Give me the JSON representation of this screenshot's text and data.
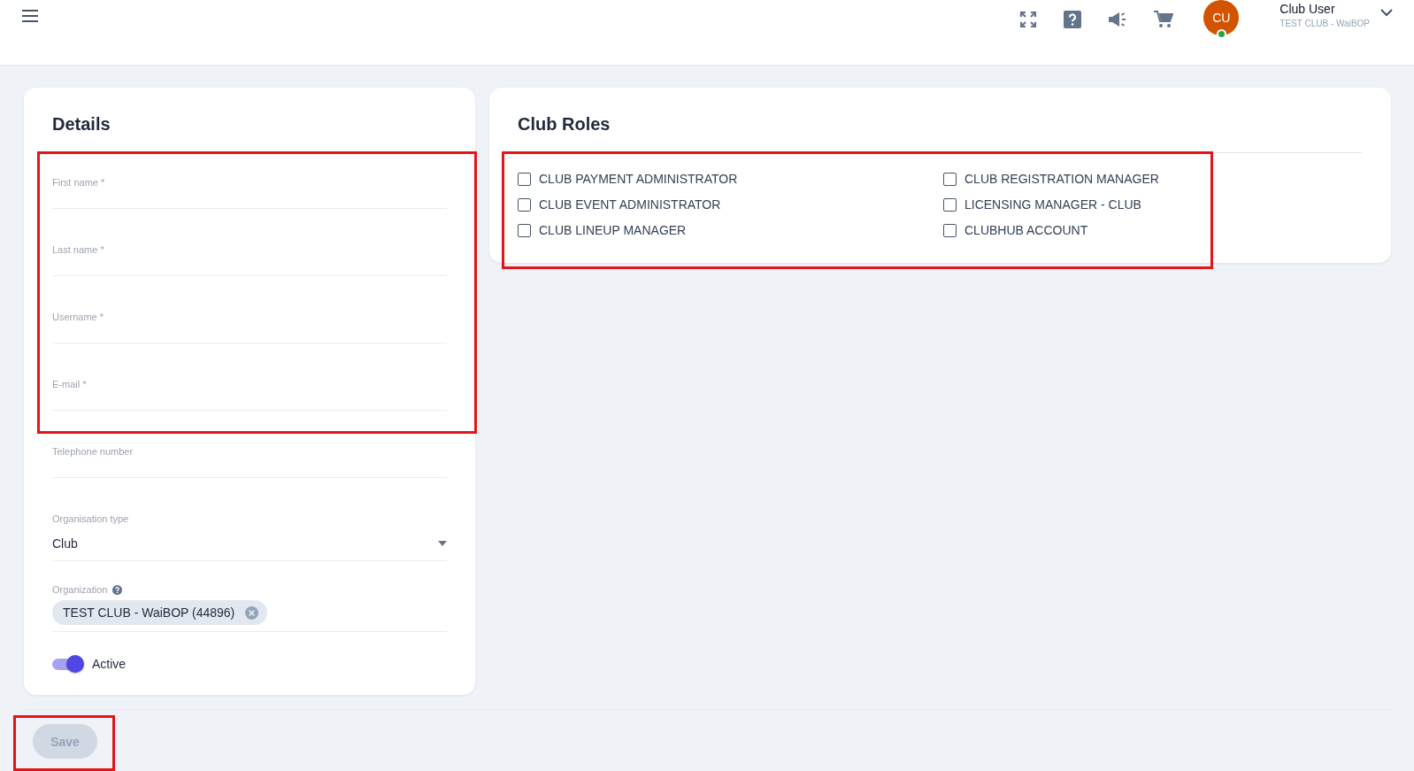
{
  "header": {
    "avatar": "CU",
    "online": true,
    "user_name": "Club User",
    "user_org": "TEST CLUB - WaiBOP"
  },
  "details": {
    "title": "Details",
    "fields": [
      {
        "kind": "text",
        "label": "First name *"
      },
      {
        "kind": "text",
        "label": "Last name *"
      },
      {
        "kind": "text",
        "label": "Username *"
      },
      {
        "kind": "text",
        "label": "E-mail *"
      },
      {
        "kind": "text",
        "label": "Telephone number"
      },
      {
        "kind": "select",
        "label": "Organisation type",
        "value": "Club"
      },
      {
        "kind": "chips",
        "label": "Organization",
        "chips": [
          "TEST CLUB - WaiBOP (44896)"
        ]
      }
    ],
    "active": {
      "label": "Active",
      "on": true
    }
  },
  "roles": {
    "title": "Club Roles",
    "items": [
      {
        "label": "CLUB PAYMENT ADMINISTRATOR",
        "checked": false
      },
      {
        "label": "CLUB REGISTRATION MANAGER",
        "checked": false
      },
      {
        "label": "CLUB EVENT ADMINISTRATOR",
        "checked": false
      },
      {
        "label": "LICENSING MANAGER - CLUB",
        "checked": false
      },
      {
        "label": "CLUB LINEUP MANAGER",
        "checked": false
      },
      {
        "label": "CLUBHUB ACCOUNT",
        "checked": false
      }
    ]
  },
  "save": {
    "label": "Save",
    "disabled": true
  }
}
